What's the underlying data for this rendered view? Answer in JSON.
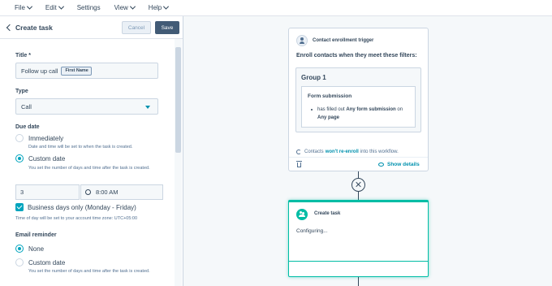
{
  "menu": [
    {
      "label": "File",
      "has_caret": true
    },
    {
      "label": "Edit",
      "has_caret": true
    },
    {
      "label": "Settings",
      "has_caret": false
    },
    {
      "label": "View",
      "has_caret": true
    },
    {
      "label": "Help",
      "has_caret": true
    }
  ],
  "panel": {
    "title": "Create task",
    "cancel_label": "Cancel",
    "save_label": "Save",
    "title_field": {
      "label": "Title *",
      "value": "Follow up call",
      "token": "First Name"
    },
    "type_field": {
      "label": "Type",
      "value": "Call"
    },
    "due_date": {
      "label": "Due date",
      "immediately_label": "Immediately",
      "immediately_help": "Date and time will be set to when the task is created.",
      "custom_label": "Custom date",
      "custom_help": "You set the number of days and time after the task is created.",
      "days_value": "3",
      "time_value": "8:00 AM",
      "business_days_label": "Business days only (Monday - Friday)",
      "timezone_help": "Time of day will be set to your account time zone: UTC+05:00"
    },
    "email_reminder": {
      "label": "Email reminder",
      "none_label": "None",
      "custom_label": "Custom date",
      "custom_help": "You set the number of days and time after the task is created."
    }
  },
  "canvas": {
    "trigger": {
      "title": "Contact enrollment trigger",
      "enroll_text": "Enroll contacts when they meet these filters:",
      "group_title": "Group 1",
      "filter_title": "Form submission",
      "filter_prefix": "has filled out",
      "filter_form": "Any form submission",
      "filter_on": "on",
      "filter_page": "Any page",
      "reenroll_prefix": "Contacts",
      "reenroll_link": "won't re-enroll",
      "reenroll_suffix": "into this workflow.",
      "show_details": "Show details"
    },
    "action": {
      "title": "Create task",
      "status": "Configuring..."
    }
  },
  "colors": {
    "accent": "#00a4bd",
    "action_border": "#00bda5",
    "save_bg": "#425b76",
    "link": "#0091ae"
  }
}
